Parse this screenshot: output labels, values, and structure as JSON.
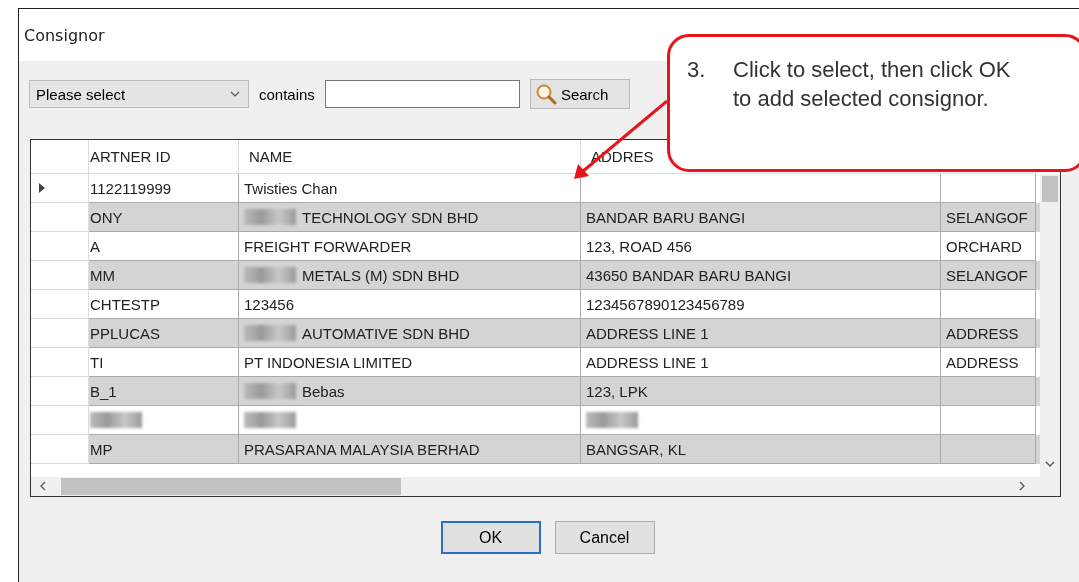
{
  "window": {
    "title": "Consignor"
  },
  "filter": {
    "field": "Please select",
    "contains_label": "contains",
    "search_button": "Search"
  },
  "table": {
    "columns": [
      "ARTNER ID",
      "NAME",
      "ADDRES"
    ],
    "rows": [
      {
        "selected": true,
        "cells": [
          {
            "text": "1122119999"
          },
          {
            "text": "Twisties Chan"
          },
          {},
          {}
        ]
      },
      {
        "selected": false,
        "cells": [
          {
            "text": "ONY"
          },
          {
            "text": "TECHNOLOGY SDN BHD",
            "redacted": true
          },
          {
            "text": "BANDAR BARU BANGI"
          },
          {
            "text": "SELANGOF"
          }
        ]
      },
      {
        "selected": false,
        "cells": [
          {
            "text": "A"
          },
          {
            "text": "FREIGHT FORWARDER"
          },
          {
            "text": "123, ROAD 456"
          },
          {
            "text": "ORCHARD"
          }
        ]
      },
      {
        "selected": false,
        "cells": [
          {
            "text": "MM"
          },
          {
            "text": "METALS (M) SDN BHD",
            "redacted": true
          },
          {
            "text": "43650 BANDAR BARU BANGI"
          },
          {
            "text": "SELANGOF"
          }
        ]
      },
      {
        "selected": false,
        "cells": [
          {
            "text": "CHTESTP"
          },
          {
            "text": "123456"
          },
          {
            "text": "1234567890123456789"
          },
          {}
        ]
      },
      {
        "selected": false,
        "cells": [
          {
            "text": "PPLUCAS"
          },
          {
            "text": "AUTOMATIVE SDN BHD",
            "redacted": true
          },
          {
            "text": "ADDRESS LINE 1"
          },
          {
            "text": "ADDRESS"
          }
        ]
      },
      {
        "selected": false,
        "cells": [
          {
            "text": "TI"
          },
          {
            "text": "PT INDONESIA LIMITED"
          },
          {
            "text": "ADDRESS LINE 1"
          },
          {
            "text": "ADDRESS"
          }
        ]
      },
      {
        "selected": false,
        "cells": [
          {
            "text": "B_1"
          },
          {
            "text": "Bebas",
            "redacted": true
          },
          {
            "text": "123, LPK"
          },
          {}
        ]
      },
      {
        "selected": false,
        "cells": [
          {
            "redacted": true
          },
          {
            "redacted": true
          },
          {
            "redacted": true
          },
          {}
        ]
      },
      {
        "selected": false,
        "cells": [
          {
            "text": "MP"
          },
          {
            "text": "PRASARANA MALAYSIA BERHAD"
          },
          {
            "text": "BANGSAR, KL"
          },
          {}
        ]
      }
    ]
  },
  "buttons": [
    "OK",
    "Cancel"
  ],
  "callout": {
    "number": "3.",
    "text": "Click to select, then click OK to add selected consignor."
  }
}
